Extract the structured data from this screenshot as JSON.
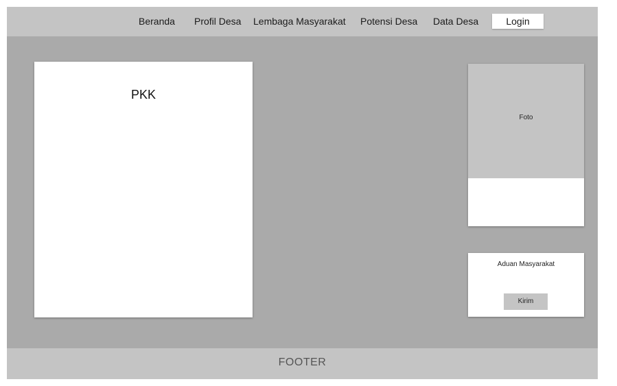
{
  "nav": {
    "items": [
      {
        "label": "Beranda"
      },
      {
        "label": "Profil Desa"
      },
      {
        "label": "Lembaga Masyarakat"
      },
      {
        "label": "Potensi Desa"
      },
      {
        "label": "Data Desa"
      }
    ],
    "login_label": "Login"
  },
  "content": {
    "title": "PKK"
  },
  "sidebar": {
    "photo_label": "Foto",
    "complaint_title": "Aduan Masyarakat",
    "send_label": "Kirim"
  },
  "footer": {
    "text": "FOOTER"
  }
}
